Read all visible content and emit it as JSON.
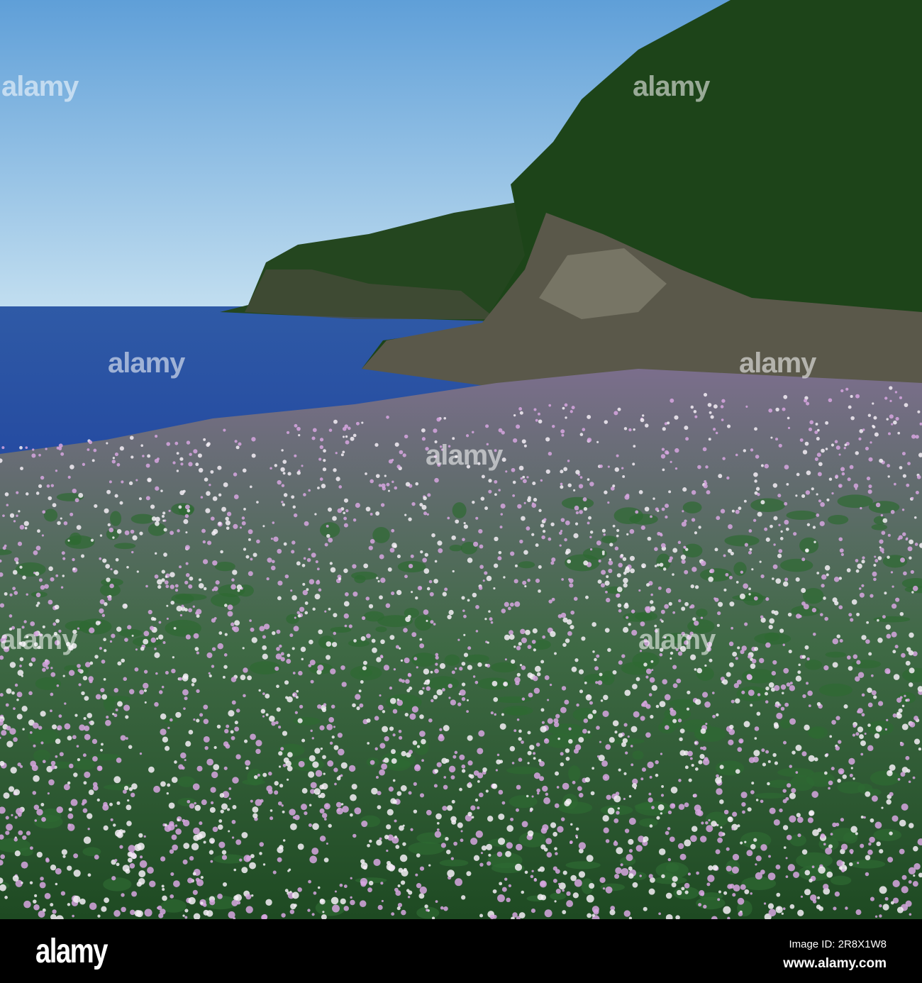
{
  "photo": {
    "subject": "wild radish flowers by the sea",
    "colors": {
      "sky_top": "#5f9fd8",
      "sky_bottom": "#b9d9ee",
      "sea": "#2c56a8",
      "forest": "#1f4a1c",
      "rock": "#5d5a4c",
      "flower_pink": "#d7a6e0",
      "flower_white": "#f4eef6",
      "foliage": "#2e6a32"
    }
  },
  "watermark": {
    "text": "alamy"
  },
  "footer": {
    "logo": "alamy",
    "image_id": "Image ID: 2R8X1W8",
    "site": "www.alamy.com"
  }
}
